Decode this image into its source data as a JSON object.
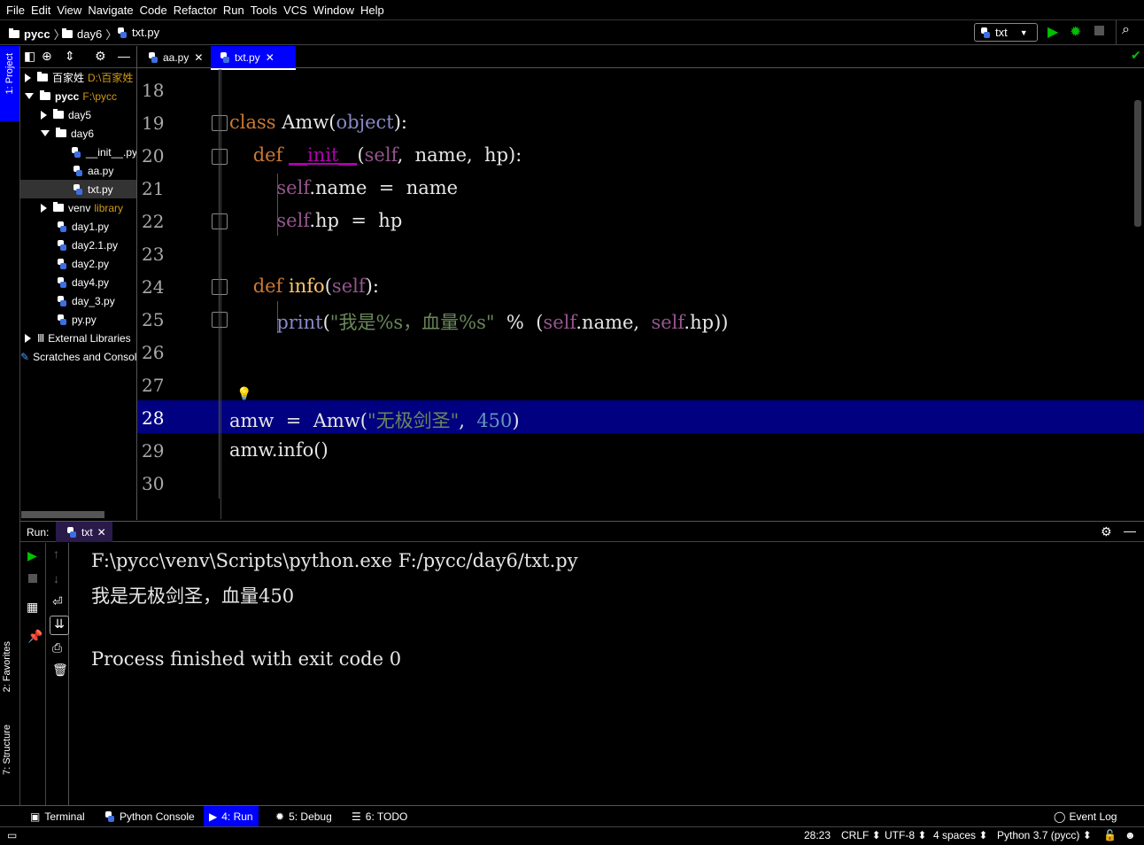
{
  "menu": [
    "File",
    "Edit",
    "View",
    "Navigate",
    "Code",
    "Refactor",
    "Run",
    "Tools",
    "VCS",
    "Window",
    "Help"
  ],
  "breadcrumb": [
    "pycc",
    "day6",
    "txt.py"
  ],
  "run_config": "txt",
  "project_panel": {
    "tab_label": "1: Project",
    "tree": [
      {
        "label": "百家姓",
        "hint": "D:\\百家姓",
        "indent": 0,
        "expanded": false,
        "type": "folder"
      },
      {
        "label": "pycc",
        "hint": "F:\\pycc",
        "indent": 0,
        "expanded": true,
        "type": "folder"
      },
      {
        "label": "day5",
        "hint": "",
        "indent": 1,
        "expanded": false,
        "type": "folder"
      },
      {
        "label": "day6",
        "hint": "",
        "indent": 1,
        "expanded": true,
        "type": "folder"
      },
      {
        "label": "__init__.py",
        "hint": "",
        "indent": 3,
        "type": "py"
      },
      {
        "label": "aa.py",
        "hint": "",
        "indent": 3,
        "type": "py"
      },
      {
        "label": "txt.py",
        "hint": "",
        "indent": 3,
        "type": "py",
        "selected": true
      },
      {
        "label": "venv",
        "hint": "library",
        "indent": 1,
        "expanded": false,
        "type": "folder"
      },
      {
        "label": "day1.py",
        "hint": "",
        "indent": 2,
        "type": "py"
      },
      {
        "label": "day2.1.py",
        "hint": "",
        "indent": 2,
        "type": "py"
      },
      {
        "label": "day2.py",
        "hint": "",
        "indent": 2,
        "type": "py"
      },
      {
        "label": "day4.py",
        "hint": "",
        "indent": 2,
        "type": "py"
      },
      {
        "label": "day_3.py",
        "hint": "",
        "indent": 2,
        "type": "py"
      },
      {
        "label": "py.py",
        "hint": "",
        "indent": 2,
        "type": "py"
      },
      {
        "label": "External Libraries",
        "hint": "",
        "indent": 0,
        "expanded": false,
        "type": "lib"
      },
      {
        "label": "Scratches and Consoles",
        "hint": "",
        "indent": 0,
        "type": "scratch"
      }
    ]
  },
  "editor_tabs": [
    {
      "label": "aa.py",
      "active": false
    },
    {
      "label": "txt.py",
      "active": true
    }
  ],
  "editor": {
    "line_numbers": [
      "18",
      "19",
      "20",
      "21",
      "22",
      "23",
      "24",
      "25",
      "26",
      "27",
      "28",
      "29",
      "30"
    ],
    "current_line": "28"
  },
  "run_panel": {
    "label": "Run:",
    "tab": "txt",
    "output": [
      "F:\\pycc\\venv\\Scripts\\python.exe F:/pycc/day6/txt.py",
      "我是无极剑圣，血量450",
      "",
      "Process finished with exit code 0"
    ]
  },
  "left_strip": {
    "favorites": "2: Favorites",
    "structure": "7: Structure"
  },
  "tool_windows": [
    "Terminal",
    "Python Console",
    "4: Run",
    "5: Debug",
    "6: TODO"
  ],
  "event_log": "Event Log",
  "status": {
    "position": "28:23",
    "line_sep": "CRLF",
    "encoding": "UTF-8",
    "indent": "4 spaces",
    "interpreter": "Python 3.7 (pycc)"
  },
  "colors": {
    "accent": "#0000ff",
    "highlight_line": "#000080",
    "keyword": "#cc7832",
    "self": "#94558d",
    "string": "#6a8759",
    "number": "#6897bb",
    "run_green": "#00c000"
  }
}
